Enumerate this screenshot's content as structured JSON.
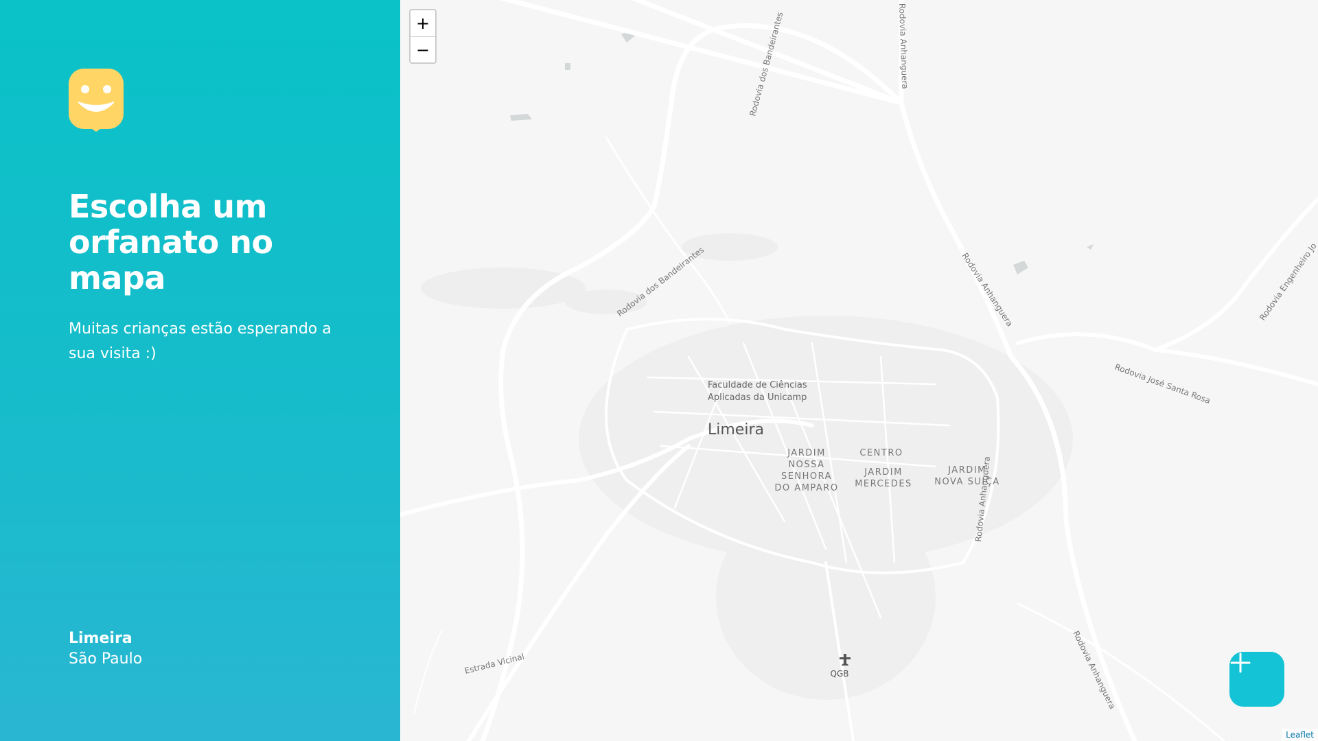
{
  "sidebar": {
    "title": "Escolha um orfanato no mapa",
    "subtitle": "Muitas crianças estão esperando a sua visita :)",
    "city": "Limeira",
    "state": "São Paulo"
  },
  "map": {
    "zoom_in": "+",
    "zoom_out": "−",
    "attribution": "Leaflet",
    "labels": {
      "city": "Limeira",
      "faculdade_1": "Faculdade de Ciências",
      "faculdade_2": "Aplicadas da Unicamp",
      "centro": "CENTRO",
      "nsa_1": "JARDIM",
      "nsa_2": "NOSSA",
      "nsa_3": "SENHORA",
      "nsa_4": "DO AMPARO",
      "merc_1": "JARDIM",
      "merc_2": "MERCEDES",
      "suica_1": "JARDIM",
      "suica_2": "NOVA SUIÇA",
      "airport": "QGB",
      "road_band_top": "Rodovia dos Bandeirantes",
      "road_band_mid": "Rodovia dos Bandeirantes",
      "road_band_low": "Rodovia dos Bandeirantes",
      "road_anh_top": "Rodovia Anhanguera",
      "road_anh_mid": "Rodovia Anhanguera",
      "road_anh_low": "Rodovia Anhanguera",
      "road_anh_bottom": "Rodovia Anhanguera",
      "road_eng": "Rodovia Engenheiro Jo",
      "road_jsr": "Rodovia José Santa Rosa",
      "road_vicinal": "Estrada Vicinal"
    }
  },
  "colors": {
    "sidebar_top": "#0ac2c8",
    "sidebar_bottom": "#29b6d2",
    "logo": "#ffd666",
    "add_button": "#15c3d6",
    "map_bg": "#f6f6f6"
  },
  "icons": {
    "logo": "happy-face-pin-icon",
    "add": "plus-icon",
    "airport": "airplane-icon"
  }
}
